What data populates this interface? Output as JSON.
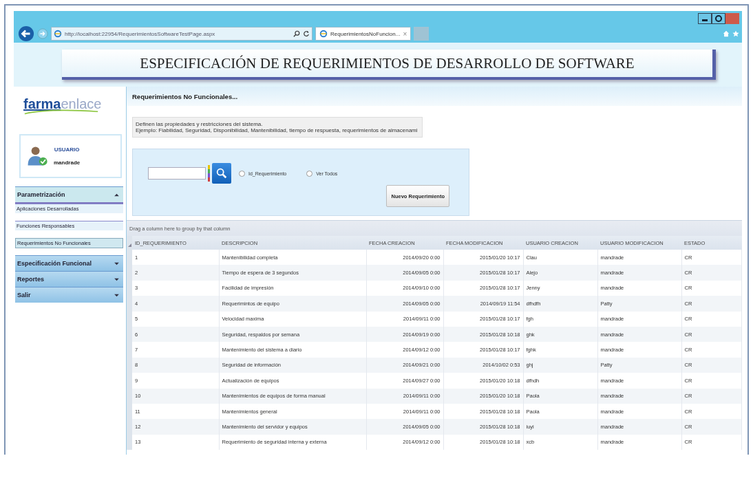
{
  "browser": {
    "address": "http://localhost:22954/RequerimientosSoftwareTestPage.aspx",
    "tab": {
      "label": "RequerimientosNoFuncion...",
      "close": "×",
      "selected": true
    }
  },
  "header": {
    "title": "ESPECIFICACIÓN DE REQUERIMIENTOS DE DESARROLLO DE SOFTWARE"
  },
  "sidebar": {
    "logo": {
      "bold": "farma",
      "light": "enlace"
    },
    "user": {
      "label": "USUARIO",
      "name": "mandrade"
    },
    "sections": [
      {
        "label": "Parametrización",
        "expanded": true,
        "children": [
          {
            "label": "Aplicaciones Desarrolladas",
            "selected": false
          },
          {
            "label": "Funciones Responsables",
            "selected": false
          },
          {
            "label": "Requerimientos No Funcionales",
            "selected": true
          }
        ]
      },
      {
        "label": "Especificación Funcional",
        "expanded": false
      },
      {
        "label": "Reportes",
        "expanded": false
      },
      {
        "label": "Salir",
        "expanded": false
      }
    ]
  },
  "page": {
    "title": "Requerimientos No Funcionales...",
    "description": [
      "Definen las propiedades y restricciones del sistema.",
      "Ejemplo: Fiabilidad, Seguridad, Disponibilidad, Mantenibilidad, tiempo de respuesta, requerimientos de almacenami"
    ],
    "radios": [
      {
        "label": "Id_Requerimiento",
        "checked": false
      },
      {
        "label": "Ver Todos",
        "checked": false
      }
    ],
    "new_button": "Nuevo Requerimiento"
  },
  "grid": {
    "group_hint": "Drag a column here to group by that column",
    "columns": [
      "ID_REQUERIMIENTO",
      "DESCRIPCION",
      "FECHA CREACION",
      "FECHA MODIFICACION",
      "USUARIO CREACION",
      "USUARIO MODIFICACION",
      "ESTADO"
    ],
    "rows": [
      [
        "1",
        "Mantenibilidad completa",
        "2014/09/20 0:00",
        "2015/01/20 10:17",
        "Clau",
        "mandrade",
        "CR"
      ],
      [
        "2",
        "Tiempo de espera de 3 segundos",
        "2014/09/05 0:00",
        "2015/01/28 10:17",
        "Alejo",
        "mandrade",
        "CR"
      ],
      [
        "3",
        "Facilidad de impresión",
        "2014/09/10 0:00",
        "2015/01/28 10:17",
        "Jenny",
        "mandrade",
        "CR"
      ],
      [
        "4",
        "Requerimintos de equipo",
        "2014/09/05 0:00",
        "2014/09/19 11:54",
        "dfhdfh",
        "Patty",
        "CR"
      ],
      [
        "5",
        "Velocidad maxima",
        "2014/09/11 0:00",
        "2015/01/28 10:17",
        "fgh",
        "mandrade",
        "CR"
      ],
      [
        "6",
        "Seguridad, respaldos por semana",
        "2014/09/19 0:00",
        "2015/01/28 10:18",
        "ghk",
        "mandrade",
        "CR"
      ],
      [
        "7",
        "Mantenimiento del sistema a diario",
        "2014/09/12 0:00",
        "2015/01/28 10:17",
        "fghk",
        "mandrade",
        "CR"
      ],
      [
        "8",
        "Seguridad de  información",
        "2014/09/21 0:00",
        "2014/10/02 0:53",
        "ghj",
        "Patty",
        "CR"
      ],
      [
        "9",
        "Actualización de equipos",
        "2014/09/27 0:00",
        "2015/01/20 10:18",
        "dfhdh",
        "mandrade",
        "CR"
      ],
      [
        "10",
        "Mantenimientos de equipos de forma manual",
        "2014/09/11 0:00",
        "2015/01/20 10:18",
        "Paola",
        "mandrade",
        "CR"
      ],
      [
        "11",
        "Mantenimientos general",
        "2014/09/11 0:00",
        "2015/01/28 10:18",
        "Paola",
        "mandrade",
        "CR"
      ],
      [
        "12",
        "Mantenimiento del servidor y equipos",
        "2014/09/05 0:00",
        "2015/01/28 10:18",
        "iuyi",
        "mandrade",
        "CR"
      ],
      [
        "13",
        "Requerimiento de seguridad interna y externa",
        "2014/09/12 0:00",
        "2015/01/28 10:18",
        "xcb",
        "mandrade",
        "CR"
      ]
    ]
  }
}
